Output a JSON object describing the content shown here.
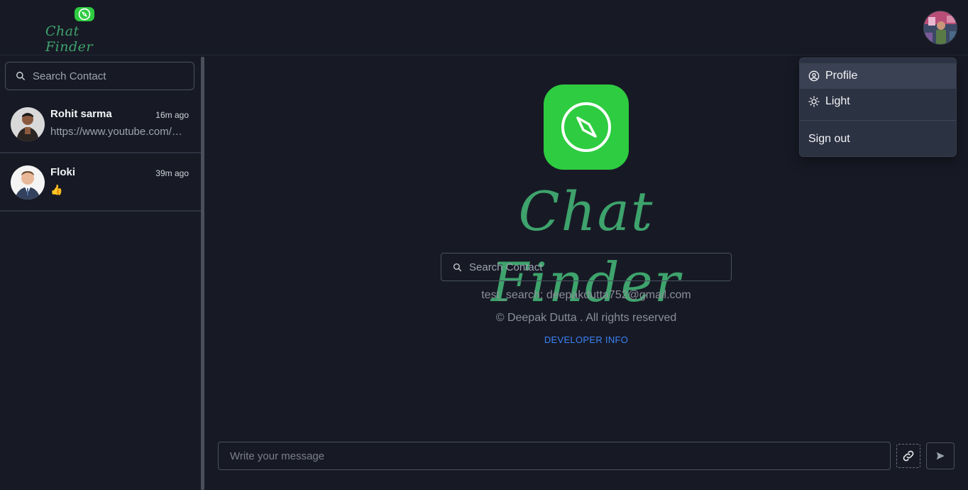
{
  "app": {
    "brand_name": "Chat Finder"
  },
  "sidebar": {
    "search_placeholder": "Search Contact",
    "contacts": [
      {
        "name": "Rohit sarma",
        "time": "16m ago",
        "last_message": "https://www.youtube.com/watch"
      },
      {
        "name": "Floki",
        "time": "39m ago",
        "last_message": "👍"
      }
    ]
  },
  "main": {
    "hero_title": "Chat Finder",
    "search_placeholder": "Search Contact",
    "test_search": "test_search: deepakdutta752@gmail.com",
    "copyright": "© Deepak Dutta . All rights reserved",
    "developer_link": "DEVELOPER INFO"
  },
  "composer": {
    "placeholder": "Write your message"
  },
  "menu": {
    "items": [
      {
        "label": "Profile",
        "icon": "user-circle-icon"
      },
      {
        "label": "Light",
        "icon": "sun-icon"
      },
      {
        "label": "Sign out",
        "icon": ""
      }
    ]
  },
  "colors": {
    "background": "#171a25",
    "brand_green": "#2ecc40",
    "title_green": "#3ea36c",
    "link_blue": "#3b82f6",
    "menu_bg": "#2b3242"
  }
}
